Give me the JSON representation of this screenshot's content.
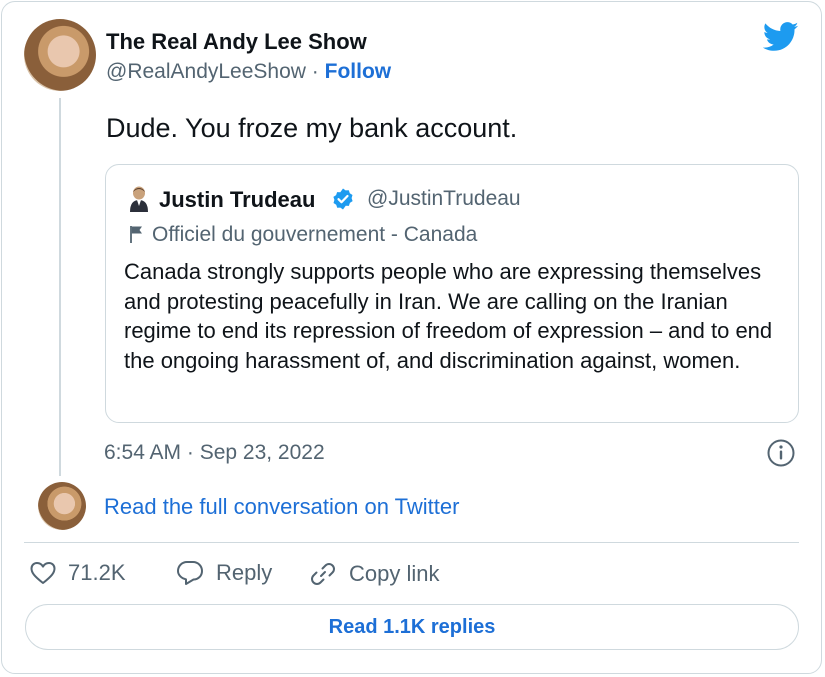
{
  "tweet": {
    "author_name": "The Real Andy Lee Show",
    "author_handle": "@RealAndyLeeShow",
    "separator": "·",
    "follow_label": "Follow",
    "text": "Dude. You froze my bank account.",
    "timestamp": "6:54 AM · Sep 23, 2022"
  },
  "quoted": {
    "author_name": "Justin Trudeau",
    "author_handle": "@JustinTrudeau",
    "label": "Officiel du gouvernement - Canada",
    "text": "Canada strongly supports people who are expressing themselves and protesting peacefully in Iran. We are calling on the Iranian regime to end its repression of freedom of expression – and to end the ongoing harassment of, and discrimination against, women."
  },
  "conversation_link": "Read the full conversation on Twitter",
  "actions": {
    "like_count": "71.2K",
    "reply_label": "Reply",
    "copy_label": "Copy link"
  },
  "read_replies_label": "Read 1.1K replies",
  "colors": {
    "accent": "#1d9bf0",
    "link": "#1d6fd6",
    "verified": "#1d9bf0",
    "muted": "#536471",
    "border": "#cfd9de"
  },
  "icons": [
    "twitter-logo-icon",
    "verified-badge-icon",
    "flag-icon",
    "info-icon",
    "heart-icon",
    "reply-bubble-icon",
    "link-icon"
  ]
}
